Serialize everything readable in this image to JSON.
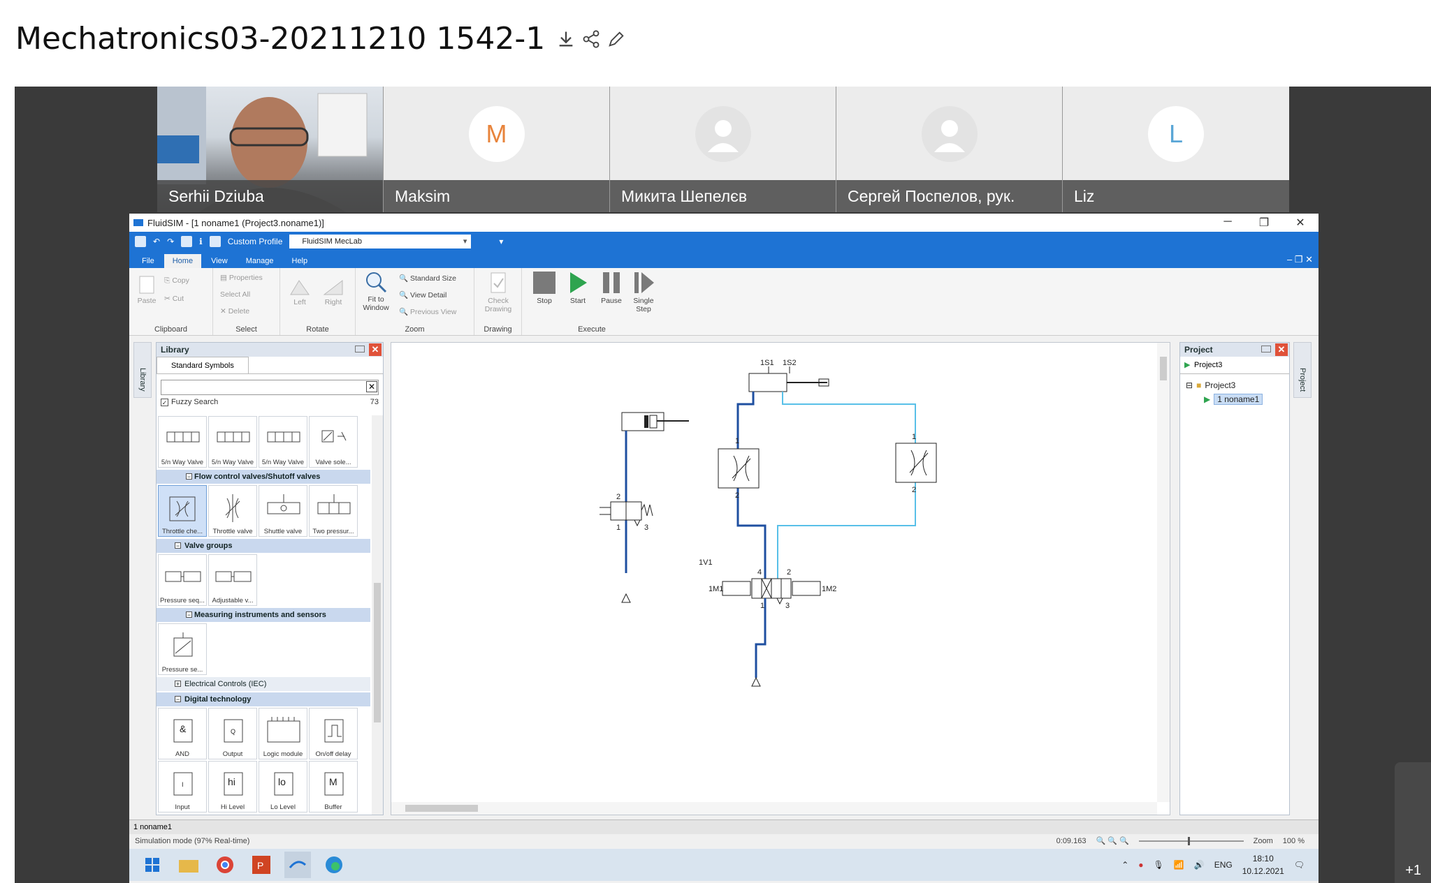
{
  "meeting": {
    "title": "Mechatronics03-20211210 1542-1",
    "more_count": "+1"
  },
  "participants": [
    {
      "name": "Serhii Dziuba",
      "initial": ""
    },
    {
      "name": "Maksim",
      "initial": "M"
    },
    {
      "name": "Микита Шепелєв",
      "initial": ""
    },
    {
      "name": "Сергей Поспелов, рук.",
      "initial": ""
    },
    {
      "name": "Liz",
      "initial": "L"
    }
  ],
  "app": {
    "window_title": "FluidSIM - [1  noname1 (Project3.noname1)]",
    "custom_profile_label": "Custom Profile",
    "profile_value": "FluidSIM MecLab",
    "menu_tabs": [
      "File",
      "Home",
      "View",
      "Manage",
      "Help"
    ],
    "active_tab": "Home",
    "ribbon": {
      "clipboard": {
        "label": "Clipboard",
        "paste": "Paste",
        "copy": "Copy",
        "cut": "Cut"
      },
      "select": {
        "label": "Select",
        "properties": "Properties",
        "select_all": "Select All",
        "delete": "Delete"
      },
      "rotate": {
        "label": "Rotate",
        "left": "Left",
        "right": "Right"
      },
      "zoom": {
        "label": "Zoom",
        "fit": "Fit to Window",
        "standard": "Standard Size",
        "detail": "View Detail",
        "previous": "Previous View"
      },
      "drawing": {
        "label": "Drawing",
        "check": "Check Drawing"
      },
      "execute": {
        "label": "Execute",
        "stop": "Stop",
        "start": "Start",
        "pause": "Pause",
        "single_step": "Single Step"
      }
    },
    "library": {
      "side_tab": "Library",
      "title": "Library",
      "tab": "Standard Symbols",
      "fuzzy_label": "Fuzzy Search",
      "count": "73",
      "row1": [
        "5/n Way Valve",
        "5/n Way Valve",
        "5/n Way Valve",
        "Valve sole..."
      ],
      "cat_flow": "Flow control valves/Shutoff valves",
      "row2": [
        "Throttle che...",
        "Throttle valve",
        "Shuttle valve",
        "Two pressur..."
      ],
      "cat_valve_groups": "Valve groups",
      "row3": [
        "Pressure seq...",
        "Adjustable v..."
      ],
      "cat_measuring": "Measuring instruments and sensors",
      "row4": [
        "Pressure se..."
      ],
      "cat_electrical": "Electrical Controls (IEC)",
      "cat_digital": "Digital technology",
      "row5": [
        "AND",
        "Output",
        "Logic module",
        "On/off delay"
      ],
      "row6_symbols": [
        "I",
        "hi",
        "lo",
        "M"
      ],
      "row6": [
        "Input",
        "Hi Level",
        "Lo Level",
        "Buffer"
      ]
    },
    "project": {
      "side_tab": "Project",
      "title": "Project",
      "tab": "Project3",
      "tree_root": "Project3",
      "tree_item": "1  noname1"
    },
    "circuit_labels": {
      "s1": "1S1",
      "s2": "1S2",
      "v1": "1V1",
      "m1": "1M1",
      "m2": "1M2",
      "p1": "1",
      "p2": "2",
      "p3": "3",
      "p4": "4"
    },
    "doc_tab": "1  noname1",
    "status_left": "Simulation mode (97% Real-time)",
    "sim_time": "0:09.163",
    "zoom_label": "Zoom",
    "zoom_value": "100 %",
    "tray_lang": "ENG",
    "clock_time": "18:10",
    "clock_date": "10.12.2021"
  }
}
